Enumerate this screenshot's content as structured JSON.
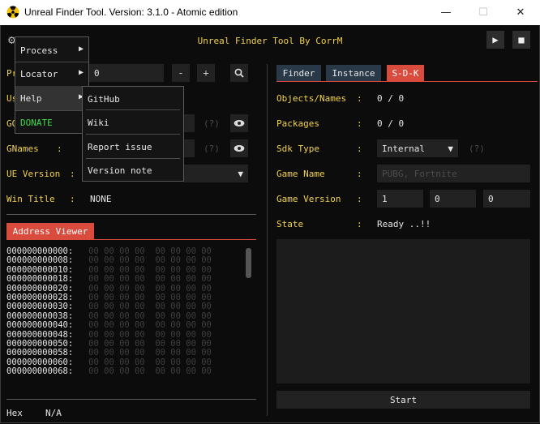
{
  "window": {
    "title": "Unreal Finder Tool. Version: 3.1.0 - Atomic edition",
    "min": "—",
    "max": "☐",
    "close": "✕"
  },
  "header": {
    "title": "Unreal Finder Tool By CorrM",
    "play": "▶",
    "stop": "■"
  },
  "left": {
    "process_label": "Pr",
    "process_value": "0",
    "minus": "-",
    "plus": "+",
    "use_label": "Us",
    "gobjects_label": "GO",
    "gnames_label": "GNames",
    "colon": ":",
    "help_q": "(?)",
    "ue_label": "UE Version",
    "ue_arrow": "▼",
    "wintitle_label": "Win Title",
    "wintitle_value": "NONE",
    "address_tab": "Address Viewer",
    "hex_label": "Hex",
    "hex_value": "N/A"
  },
  "dump": {
    "rows": [
      {
        "addr": "000000000000:",
        "bytes": "00 00 00 00  00 00 00 00"
      },
      {
        "addr": "000000000008:",
        "bytes": "00 00 00 00  00 00 00 00"
      },
      {
        "addr": "000000000010:",
        "bytes": "00 00 00 00  00 00 00 00"
      },
      {
        "addr": "000000000018:",
        "bytes": "00 00 00 00  00 00 00 00"
      },
      {
        "addr": "000000000020:",
        "bytes": "00 00 00 00  00 00 00 00"
      },
      {
        "addr": "000000000028:",
        "bytes": "00 00 00 00  00 00 00 00"
      },
      {
        "addr": "000000000030:",
        "bytes": "00 00 00 00  00 00 00 00"
      },
      {
        "addr": "000000000038:",
        "bytes": "00 00 00 00  00 00 00 00"
      },
      {
        "addr": "000000000040:",
        "bytes": "00 00 00 00  00 00 00 00"
      },
      {
        "addr": "000000000048:",
        "bytes": "00 00 00 00  00 00 00 00"
      },
      {
        "addr": "000000000050:",
        "bytes": "00 00 00 00  00 00 00 00"
      },
      {
        "addr": "000000000058:",
        "bytes": "00 00 00 00  00 00 00 00"
      },
      {
        "addr": "000000000060:",
        "bytes": "00 00 00 00  00 00 00 00"
      },
      {
        "addr": "000000000068:",
        "bytes": "00 00 00 00  00 00 00 00"
      }
    ]
  },
  "right": {
    "tabs": [
      "Finder",
      "Instance",
      "S-D-K"
    ],
    "objects_label": "Objects/Names",
    "objects_value": "0 / 0",
    "packages_label": "Packages",
    "packages_value": "0 / 0",
    "sdktype_label": "Sdk Type",
    "sdktype_value": "Internal",
    "sdktype_arrow": "▼",
    "sdktype_help": "(?)",
    "gamename_label": "Game Name",
    "gamename_placeholder": "PUBG, Fortnite",
    "gameversion_label": "Game Version",
    "gameversion": [
      "1",
      "0",
      "0"
    ],
    "state_label": "State",
    "state_value": "Ready ..!!",
    "colon": ":",
    "start": "Start"
  },
  "menu": {
    "items": [
      {
        "label": "Process",
        "arrow": "▶"
      },
      {
        "label": "Locator",
        "arrow": "▶"
      },
      {
        "label": "Help",
        "arrow": "▶"
      },
      {
        "label": "DONATE",
        "color": "#3ddc4a"
      }
    ],
    "submenu": [
      "GitHub",
      "Wiki",
      "Report issue",
      "Version note"
    ]
  }
}
